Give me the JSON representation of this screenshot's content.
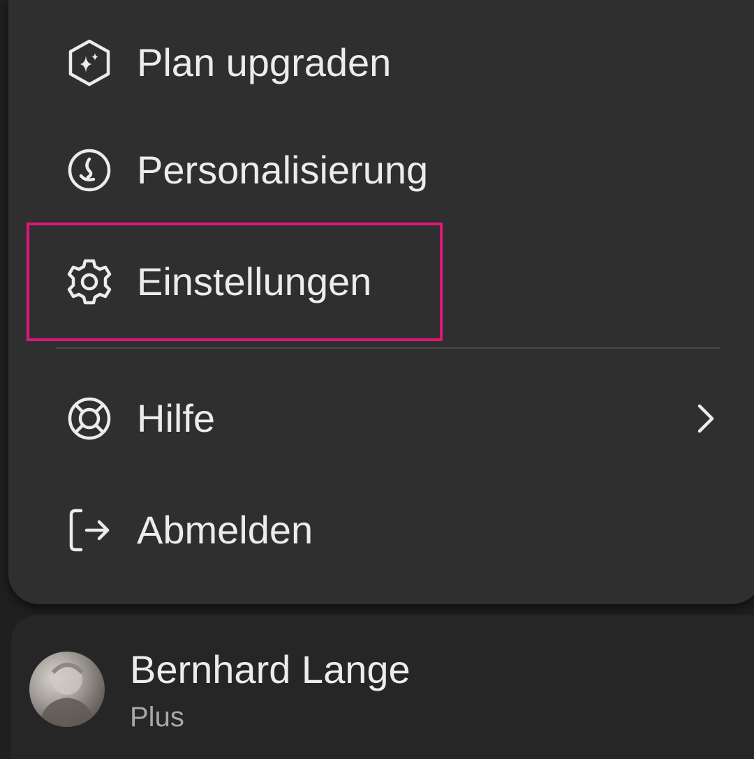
{
  "menu": {
    "items": [
      {
        "label": "Plan upgraden",
        "icon": "upgrade-sparkle-icon"
      },
      {
        "label": "Personalisierung",
        "icon": "personalization-icon"
      },
      {
        "label": "Einstellungen",
        "icon": "gear-icon"
      },
      {
        "label": "Hilfe",
        "icon": "lifebuoy-icon",
        "submenu_icon": "chevron-right-icon"
      },
      {
        "label": "Abmelden",
        "icon": "logout-icon"
      }
    ]
  },
  "account": {
    "name": "Bernhard Lange",
    "plan": "Plus",
    "avatar_icon": "user-avatar"
  },
  "colors": {
    "menu_background": "#2f2f2f",
    "page_background": "#1f1f1f",
    "account_background": "#262626",
    "text": "#ececec",
    "secondary_text": "#a8a8a8",
    "highlight": "#e0167a"
  }
}
